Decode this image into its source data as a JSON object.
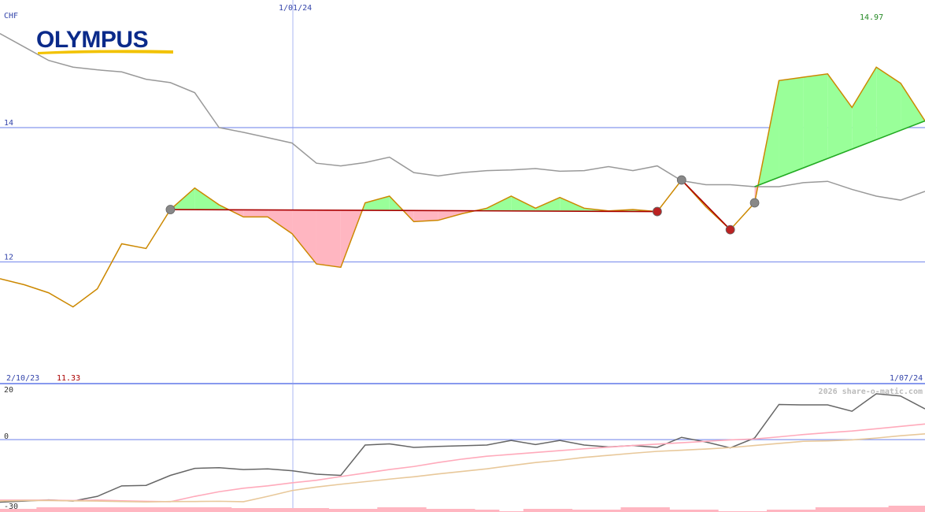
{
  "app": {
    "currency_label": "CHF",
    "logo_text": "OLYMPUS",
    "watermark": "2026 share-o-matic.com"
  },
  "labels": {
    "top_date": "1/01/24",
    "high_value": "14.97",
    "low_value": "11.33",
    "start_date": "2/10/23",
    "end_date": "1/07/24"
  },
  "colors": {
    "price_line": "#cc8800",
    "gray_line": "#999999",
    "gain_fill": "#99ff99",
    "loss_fill": "#ffb6c1",
    "trend_loss": "#aa0000",
    "trend_gain": "#22aa22",
    "grid": "#8899ee",
    "axis_text": "#3344aa",
    "high_text": "#228822",
    "low_text": "#aa0000",
    "osc_dark": "#666666",
    "osc_pink": "#ffaabb",
    "osc_tan": "#e8c89a",
    "volume": "#ffb6c1"
  },
  "chart_data": [
    {
      "type": "line",
      "panel": "main",
      "ylabel": "CHF",
      "ylim": [
        10.2,
        15.9
      ],
      "yticks": [
        {
          "value": 14,
          "label": "14"
        },
        {
          "value": 12,
          "label": "12"
        }
      ],
      "x": [
        0,
        1,
        2,
        3,
        4,
        5,
        6,
        7,
        8,
        9,
        10,
        11,
        12,
        13,
        14,
        15,
        16,
        17,
        18,
        19,
        20,
        21,
        22,
        23,
        24,
        25,
        26,
        27,
        28,
        29,
        30,
        31,
        32,
        33,
        34,
        35,
        36,
        37,
        38
      ],
      "series": [
        {
          "role": "price",
          "values": [
            11.75,
            11.66,
            11.54,
            11.33,
            11.6,
            12.27,
            12.2,
            12.78,
            13.1,
            12.85,
            12.67,
            12.67,
            12.42,
            11.97,
            11.92,
            12.88,
            12.98,
            12.6,
            12.62,
            12.72,
            12.8,
            12.98,
            12.8,
            12.96,
            12.8,
            12.76,
            12.78,
            12.75,
            13.22,
            12.82,
            12.48,
            12.88,
            14.7,
            14.75,
            14.8,
            14.3,
            14.9,
            14.66,
            14.1
          ]
        },
        {
          "role": "reference",
          "values": [
            15.4,
            15.2,
            15.0,
            14.9,
            14.86,
            14.83,
            14.72,
            14.67,
            14.52,
            14.0,
            13.93,
            13.85,
            13.77,
            13.47,
            13.43,
            13.48,
            13.56,
            13.33,
            13.28,
            13.33,
            13.36,
            13.37,
            13.39,
            13.35,
            13.36,
            13.42,
            13.36,
            13.43,
            13.21,
            13.15,
            13.15,
            13.12,
            13.12,
            13.18,
            13.2,
            13.08,
            12.98,
            12.92,
            13.05
          ]
        }
      ],
      "trend_segments": [
        {
          "start": 7,
          "end": 27,
          "from": 12.78,
          "to": 12.75,
          "kind": "loss"
        },
        {
          "start": 28,
          "end": 30,
          "from": 13.22,
          "to": 12.48,
          "kind": "loss"
        },
        {
          "start": 31,
          "end": 38,
          "from": 13.12,
          "to": 14.1,
          "kind": "gain"
        }
      ],
      "markers": [
        {
          "index": 7,
          "kind": "start"
        },
        {
          "index": 27,
          "kind": "end"
        },
        {
          "index": 28,
          "kind": "start"
        },
        {
          "index": 30,
          "kind": "end"
        },
        {
          "index": 31,
          "kind": "start"
        }
      ]
    },
    {
      "type": "line",
      "panel": "oscillator",
      "ylim": [
        -30,
        22
      ],
      "yticks": [
        {
          "value": 20,
          "label": "20"
        },
        {
          "value": 0,
          "label": "0"
        },
        {
          "value": -30,
          "label": "-30"
        }
      ],
      "x": [
        0,
        1,
        2,
        3,
        4,
        5,
        6,
        7,
        8,
        9,
        10,
        11,
        12,
        13,
        14,
        15,
        16,
        17,
        18,
        19,
        20,
        21,
        22,
        23,
        24,
        25,
        26,
        27,
        28,
        29,
        30,
        31,
        32,
        33,
        34,
        35,
        36,
        37,
        38
      ],
      "series": [
        {
          "role": "momentum",
          "values": [
            -28.5,
            -28,
            -27.5,
            -28,
            -26,
            -21.5,
            -21.3,
            -17,
            -14,
            -13.7,
            -14.5,
            -14.2,
            -15,
            -16.5,
            -17,
            -4,
            -3.5,
            -5,
            -4.6,
            -4.3,
            -4,
            -2,
            -3.8,
            -2,
            -4,
            -4.8,
            -4.2,
            -5,
            -0.7,
            -2.7,
            -5.2,
            -1,
            13.4,
            13.2,
            13.2,
            10.5,
            18,
            17,
            11.5
          ]
        },
        {
          "role": "average-a",
          "values": [
            -27.6,
            -27.6,
            -27.6,
            -27.8,
            -27.6,
            -27.9,
            -28.1,
            -28.3,
            -26,
            -24,
            -22.5,
            -21.5,
            -20.2,
            -19.1,
            -17.5,
            -16,
            -14.5,
            -13.2,
            -11.5,
            -10,
            -8.8,
            -8,
            -7.2,
            -6.4,
            -5.6,
            -4.9,
            -4.2,
            -3.6,
            -3,
            -2.4,
            -1.8,
            -1.4,
            -0.5,
            0.5,
            1.3,
            2,
            3,
            4,
            5
          ]
        },
        {
          "role": "average-b",
          "values": [
            -28,
            -27.8,
            -27.8,
            -27.9,
            -28,
            -28.2,
            -28.4,
            -28.2,
            -28.2,
            -28.1,
            -28.3,
            -26,
            -23.5,
            -22,
            -20.8,
            -19.7,
            -18.6,
            -17.6,
            -16.4,
            -15.3,
            -14.2,
            -12.8,
            -11.5,
            -10.5,
            -9.3,
            -8.4,
            -7.5,
            -6.7,
            -6.2,
            -5.7,
            -5.1,
            -4.2,
            -3.3,
            -2.4,
            -2.2,
            -1.8,
            -1,
            0,
            0.8
          ]
        }
      ]
    },
    {
      "type": "bar",
      "panel": "volume",
      "x": [
        0,
        1,
        2,
        3,
        4,
        5,
        6,
        7,
        8,
        9,
        10,
        11,
        12,
        13,
        14,
        15,
        16,
        17,
        18,
        19,
        20,
        21,
        22,
        23,
        24,
        25,
        26,
        27,
        28,
        29,
        30,
        31,
        32,
        33,
        34,
        35,
        36,
        37,
        38
      ],
      "values": [
        4,
        4,
        6,
        6,
        6,
        6,
        6,
        6,
        6,
        6,
        5,
        5,
        5,
        5,
        4,
        4,
        6,
        6,
        4,
        4,
        3,
        1,
        4,
        4,
        3,
        3,
        6,
        6,
        3,
        3,
        1,
        1,
        3,
        3,
        6,
        6,
        6,
        8,
        8
      ]
    }
  ]
}
